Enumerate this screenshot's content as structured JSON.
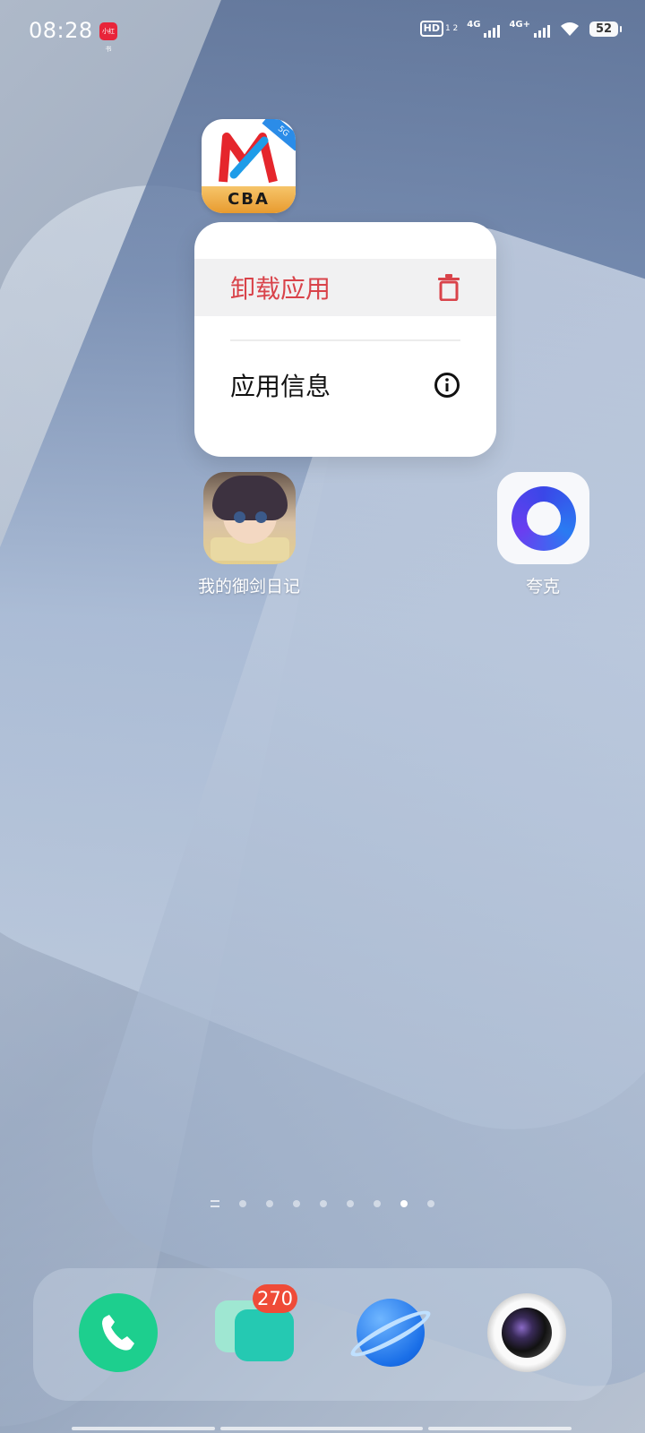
{
  "status_bar": {
    "time": "08:28",
    "notification_app": "小红书",
    "hd_label": "HD",
    "sim_slots": "1 2",
    "network1": "4G",
    "network2": "4G+",
    "battery": "52"
  },
  "pressed_app": {
    "icon_text": "CBA",
    "tag": "5G"
  },
  "context_menu": {
    "uninstall_label": "卸载应用",
    "info_label": "应用信息",
    "uninstall_color": "#d9434a"
  },
  "home_apps": [
    {
      "label": "我的御剑日记"
    },
    {
      "label": "夸克"
    }
  ],
  "dock": {
    "messages_badge": "270"
  }
}
